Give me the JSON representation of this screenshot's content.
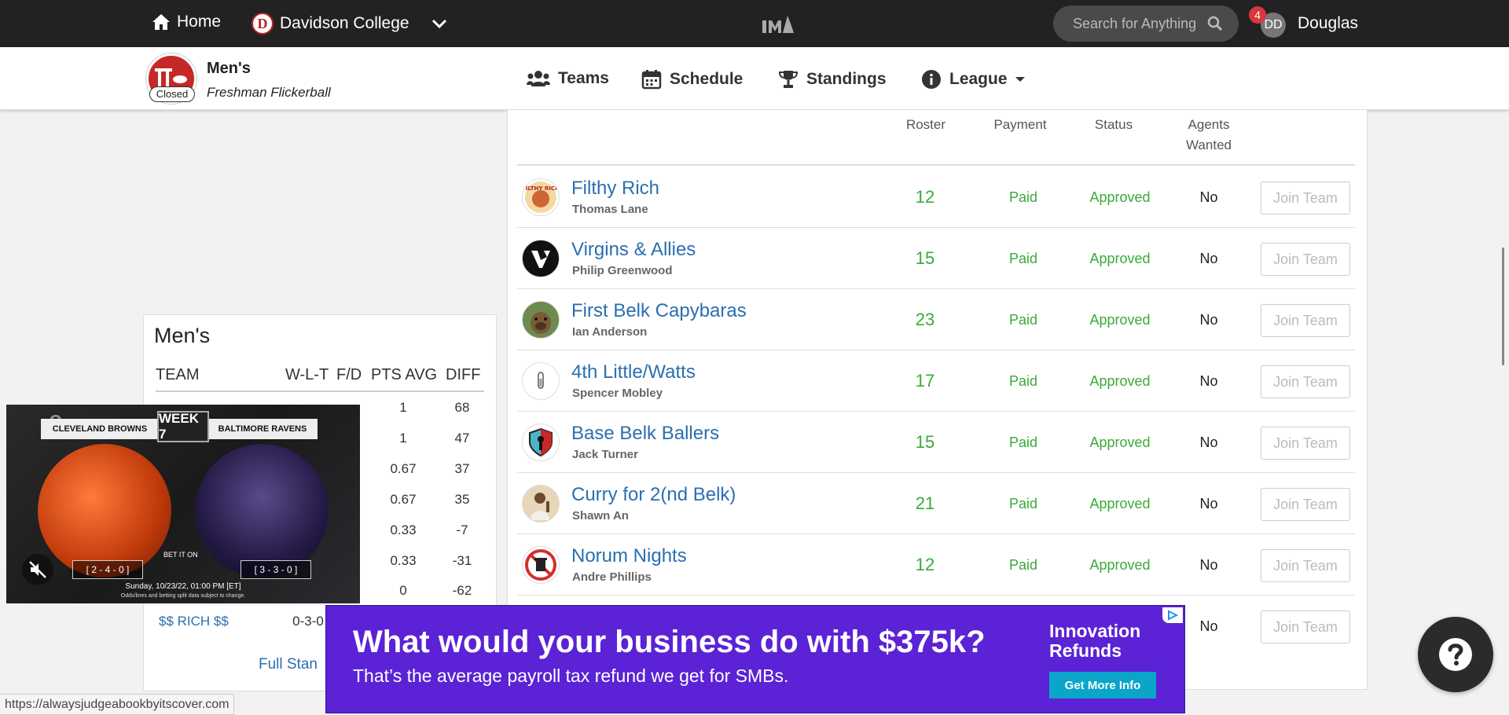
{
  "topnav": {
    "home_label": "Home",
    "school_label": "Davidson College",
    "school_logo_letter": "D",
    "search_placeholder": "Search for Anything",
    "notif_count": "4",
    "avatar_initials": "DD",
    "user_name": "Douglas"
  },
  "league": {
    "title": "Men's",
    "subtitle": "Freshman Flickerball",
    "closed_label": "Closed"
  },
  "subnav": {
    "teams": "Teams",
    "schedule": "Schedule",
    "standings": "Standings",
    "league": "League"
  },
  "columns": {
    "roster": "Roster",
    "payment": "Payment",
    "status": "Status",
    "agents_line1": "Agents",
    "agents_line2": "Wanted"
  },
  "teams": [
    {
      "name": "Filthy Rich",
      "captain": "Thomas Lane",
      "roster": "12",
      "payment": "Paid",
      "status": "Approved",
      "agents": "No",
      "join": "Join Team"
    },
    {
      "name": "Virgins & Allies",
      "captain": "Philip Greenwood",
      "roster": "15",
      "payment": "Paid",
      "status": "Approved",
      "agents": "No",
      "join": "Join Team"
    },
    {
      "name": "First Belk Capybaras",
      "captain": "Ian Anderson",
      "roster": "23",
      "payment": "Paid",
      "status": "Approved",
      "agents": "No",
      "join": "Join Team"
    },
    {
      "name": "4th Little/Watts",
      "captain": "Spencer Mobley",
      "roster": "17",
      "payment": "Paid",
      "status": "Approved",
      "agents": "No",
      "join": "Join Team"
    },
    {
      "name": "Base Belk Ballers",
      "captain": "Jack Turner",
      "roster": "15",
      "payment": "Paid",
      "status": "Approved",
      "agents": "No",
      "join": "Join Team"
    },
    {
      "name": "Curry for 2(nd Belk)",
      "captain": "Shawn An",
      "roster": "21",
      "payment": "Paid",
      "status": "Approved",
      "agents": "No",
      "join": "Join Team"
    },
    {
      "name": "Norum Nights",
      "captain": "Andre Phillips",
      "roster": "12",
      "payment": "Paid",
      "status": "Approved",
      "agents": "No",
      "join": "Join Team"
    },
    {
      "name": "",
      "captain": "",
      "roster": "",
      "payment": "",
      "status": "",
      "agents": "No",
      "join": "Join Team"
    }
  ],
  "standings": {
    "title": "Men's",
    "headers": {
      "team": "TEAM",
      "wlt": "W-L-T",
      "fd": "F/D",
      "pts": "PTS AVG",
      "diff": "DIFF"
    },
    "rows": [
      {
        "pts": "1",
        "diff": "68"
      },
      {
        "pts": "1",
        "diff": "47"
      },
      {
        "pts": "0.67",
        "diff": "37"
      },
      {
        "pts": "0.67",
        "diff": "35"
      },
      {
        "pts": "0.33",
        "diff": "-7"
      },
      {
        "pts": "0.33",
        "diff": "-31"
      },
      {
        "pts": "0",
        "diff": "-62"
      }
    ],
    "last_team": "$$ RICH $$",
    "last_wlt": "0-3-0",
    "full_link": "Full Stan"
  },
  "video": {
    "home_team": "CLEVELAND BROWNS",
    "away_team": "BALTIMORE RAVENS",
    "week": "WEEK 7",
    "home_record": "[ 2 - 4 - 0 ]",
    "away_record": "[ 3 - 3 - 0 ]",
    "bet_label": "BET IT ON",
    "date": "Sunday, 10/23/22, 01:00 PM [ET]",
    "disclaimer": "Odds/lines and betting split data subject to change."
  },
  "ad": {
    "headline": "What would your business do with $375k?",
    "subline": "That’s the average payroll tax refund we get for SMBs.",
    "brand_line1": "Innovation",
    "brand_line2": "Refunds",
    "cta": "Get More Info"
  },
  "status_url": "https://alwaysjudgeabookbyitscover.com"
}
